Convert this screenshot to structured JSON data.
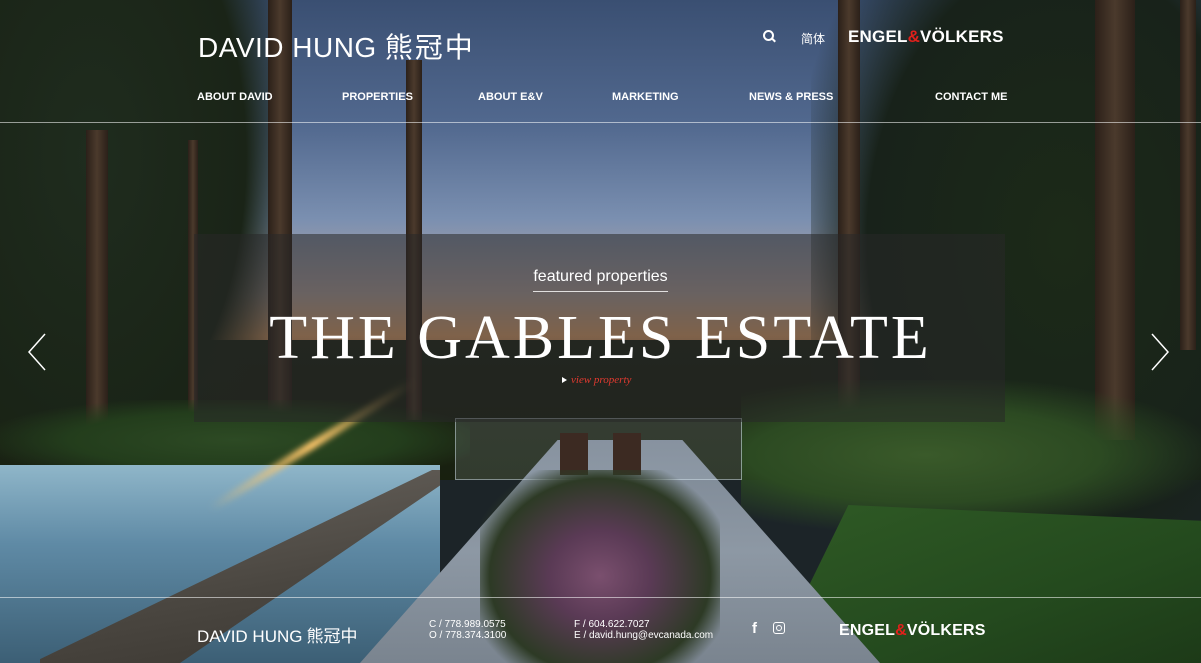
{
  "header": {
    "logo_name": "DAVID HUNG",
    "logo_cn": "熊冠中",
    "lang_label": "简体",
    "brand_left": "ENGEL",
    "brand_amp": "&",
    "brand_right": "VÖLKERS",
    "search_icon": "search-icon"
  },
  "nav": [
    {
      "label": "ABOUT DAVID"
    },
    {
      "label": "PROPERTIES"
    },
    {
      "label": "ABOUT E&V"
    },
    {
      "label": "MARKETING"
    },
    {
      "label": "NEWS & PRESS"
    },
    {
      "label": "CONTACT ME"
    }
  ],
  "feature": {
    "kicker": "featured properties",
    "title": "THE GABLES ESTATE",
    "link": "view property"
  },
  "carousel": {
    "prev_icon": "chevron-left-icon",
    "next_icon": "chevron-right-icon"
  },
  "footer": {
    "logo_name": "DAVID HUNG",
    "logo_cn": "熊冠中",
    "cell": "C / 778.989.0575",
    "office": "O / 778.374.3100",
    "fax": "F / 604.622.7027",
    "email": "E / david.hung@evcanada.com",
    "brand_left": "ENGEL",
    "brand_amp": "&",
    "brand_right": "VÖLKERS"
  },
  "colors": {
    "accent_red": "#e0201b",
    "link_red": "#e23a30",
    "overlay": "rgba(40,40,40,0.55)"
  }
}
